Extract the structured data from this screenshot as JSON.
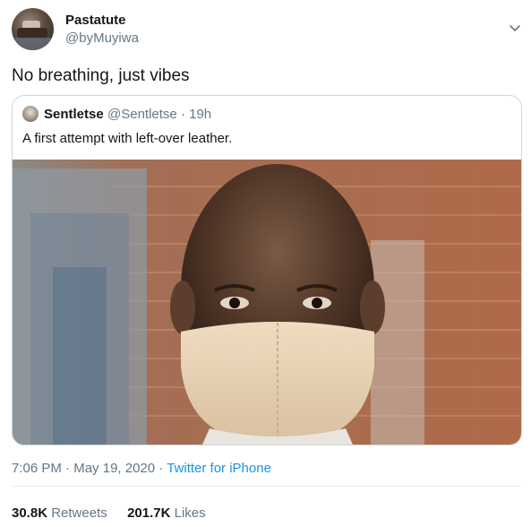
{
  "tweet": {
    "author_name": "Pastatute",
    "author_handle": "@byMuyiwa",
    "text": "No breathing, just vibes",
    "time": "7:06 PM",
    "date": "May 19, 2020",
    "source": "Twitter for iPhone",
    "separator": "·"
  },
  "quoted": {
    "author_name": "Sentletse",
    "author_handle": "@Sentletse",
    "age": "19h",
    "separator": "·",
    "text": "A first attempt with left-over leather."
  },
  "stats": {
    "retweets_count": "30.8K",
    "retweets_label": "Retweets",
    "likes_count": "201.7K",
    "likes_label": "Likes"
  },
  "icons": {
    "caret": "chevron-down-icon"
  },
  "colors": {
    "link": "#1b95e0",
    "secondary_text": "#657786",
    "border": "#ccd6dd"
  }
}
